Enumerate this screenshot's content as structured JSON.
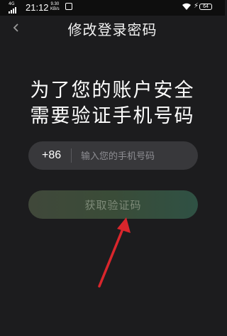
{
  "status_bar": {
    "network": "4G",
    "time": "21:12",
    "speed_value": "9.30",
    "speed_unit": "KB/s",
    "battery": "64"
  },
  "header": {
    "title": "修改登录密码"
  },
  "main": {
    "headline_line1": "为了您的账户安全",
    "headline_line2": "需要验证手机号码",
    "phone": {
      "country_code": "+86",
      "placeholder": "输入您的手机号码",
      "value": ""
    },
    "get_code_label": "获取验证码"
  },
  "annotation_color": "#d9262c"
}
